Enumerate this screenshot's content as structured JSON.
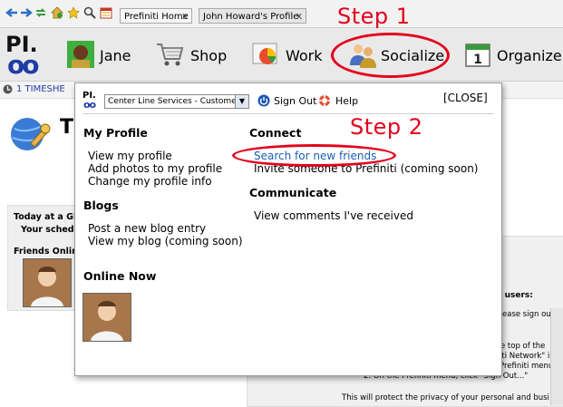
{
  "browser": {
    "tabs": [
      {
        "label": "Prefiniti Home",
        "close": "x",
        "active": false
      },
      {
        "label": "John Howard's Profile",
        "close": "x",
        "active": true
      }
    ]
  },
  "logo": {
    "text_top": "PI.",
    "text_bottom": "oo"
  },
  "nav": {
    "items": [
      {
        "label": "Jane",
        "icon": "avatar-icon"
      },
      {
        "label": "Shop",
        "icon": "shopping-cart-icon"
      },
      {
        "label": "Work",
        "icon": "pie-chart-icon"
      },
      {
        "label": "Socialize",
        "icon": "people-icon"
      },
      {
        "label": "Organize",
        "icon": "calendar-icon"
      }
    ]
  },
  "annotations": {
    "step1": "Step 1",
    "step2": "Step 2",
    "color": "#e3001b"
  },
  "background": {
    "timesheet": "1 TIMESHE",
    "title_letter": "T",
    "today_line1": "Today at a Gl",
    "today_line2": "Your schedu",
    "friends_online": "Friends Onlin",
    "right_bold": "r users:",
    "right_lines": [
      "ease sign out a",
      "e top of the",
      "iti Network\" is",
      "Prefiniti menu.",
      "2.  On the Prefiniti menu, click \"Sign Out...\"",
      "This will protect the privacy of your personal and busi"
    ]
  },
  "panel": {
    "select_value": "Center Line Services  - Customer",
    "sign_out": "Sign Out",
    "help": "Help",
    "close": "[CLOSE]",
    "my_profile": {
      "heading": "My Profile",
      "items": [
        "View my profile",
        "Add photos to my profile",
        "Change my profile info"
      ]
    },
    "blogs": {
      "heading": "Blogs",
      "items": [
        "Post a new blog entry",
        "View my blog (coming soon)"
      ]
    },
    "online_now": "Online Now",
    "connect": {
      "heading": "Connect",
      "search": "Search for new friends",
      "invite": "Invite someone to Prefiniti (coming soon)"
    },
    "communicate": {
      "heading": "Communicate",
      "items": [
        "View comments I've received"
      ]
    }
  }
}
